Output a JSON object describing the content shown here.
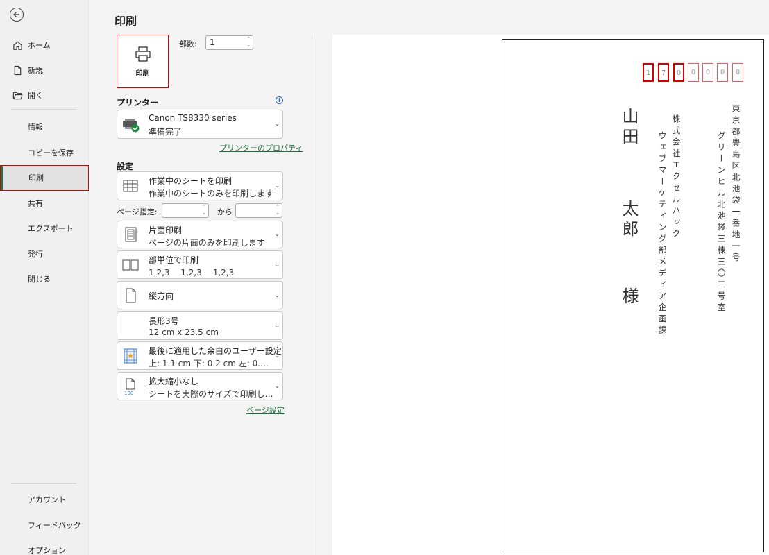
{
  "page_title": "印刷",
  "sidebar": {
    "nav_top": [
      {
        "label": "ホーム",
        "icon": "home-icon"
      },
      {
        "label": "新規",
        "icon": "new-file-icon"
      },
      {
        "label": "開く",
        "icon": "folder-open-icon"
      }
    ],
    "nav_mid": [
      "情報",
      "コピーを保存",
      "印刷",
      "共有",
      "エクスポート",
      "発行",
      "閉じる"
    ],
    "nav_bottom": [
      "アカウント",
      "フィードバック",
      "オプション"
    ]
  },
  "print": {
    "button_label": "印刷",
    "copies_label": "部数:",
    "copies_value": "1"
  },
  "printer": {
    "heading": "プリンター",
    "name": "Canon TS8330 series",
    "status": "準備完了",
    "properties_link": "プリンターのプロパティ"
  },
  "settings": {
    "heading": "設定",
    "scope": {
      "title": "作業中のシートを印刷",
      "desc": "作業中のシートのみを印刷します"
    },
    "pages_label": "ページ指定:",
    "pages_to": "から",
    "sides": {
      "title": "片面印刷",
      "desc": "ページの片面のみを印刷します"
    },
    "collate": {
      "title": "部単位で印刷",
      "desc": "1,2,3　 1,2,3　 1,2,3"
    },
    "orientation": "縦方向",
    "paper": {
      "title": "長形3号",
      "desc": "12 cm x 23.5 cm"
    },
    "margins": {
      "title": "最後に適用した余白のユーザー設定",
      "desc": "上: 1.1 cm 下: 0.2 cm 左: 0.…"
    },
    "scaling": {
      "title": "拡大縮小なし",
      "desc": "シートを実際のサイズで印刷します",
      "icon_text": "100"
    },
    "page_setup_link": "ページ設定"
  },
  "envelope": {
    "zip_digits": [
      "1",
      "7",
      "0",
      "0",
      "0",
      "0",
      "0"
    ],
    "highlighted_digits": 3,
    "address_line1": "東京都豊島区北池袋一番地一号",
    "address_line2": "グリーンヒル北池袋三棟三〇二号室",
    "company": "株式会社エクセルハック",
    "department": "ウェブマーケティング部メディア企画課",
    "name_surname": "山田",
    "name_given": "太郎",
    "honorific": "様"
  },
  "colors": {
    "accent_green": "#217346",
    "highlight_red": "#d40000",
    "link_green": "#1e6e3c"
  }
}
